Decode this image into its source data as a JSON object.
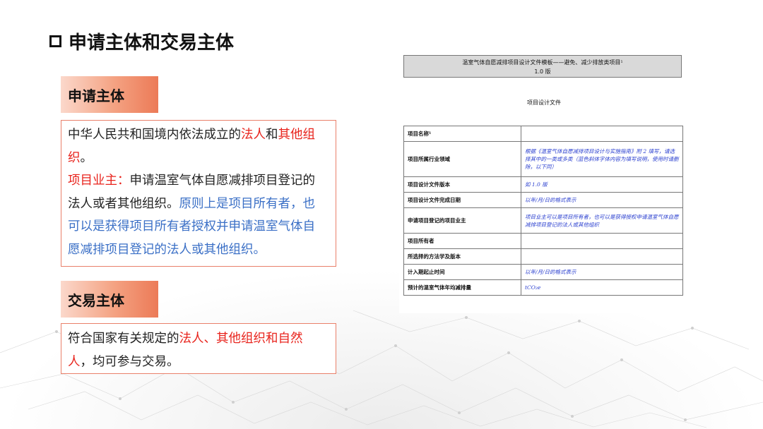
{
  "title": "申请主体和交易主体",
  "apply": {
    "label": "申请主体",
    "p1_a": "中华人民共和国境内依法成立的",
    "p1_red1": "法人",
    "p1_b": "和",
    "p1_red2": "其他组织",
    "p1_c": "。",
    "p2_red": "项目业主：",
    "p2_a": "申请温室气体自愿减排项目登记的法人或者其他组织。",
    "p2_blue": "原则上是项目所有者，也可以是获得项目所有者授权并申请温室气体自愿减排项目登记的法人或其他组织。"
  },
  "trade": {
    "label": "交易主体",
    "a": "符合国家有关规定的",
    "red": "法人、其他组织和自然人",
    "b": "，均可参与交易。"
  },
  "doc": {
    "header_line1": "温室气体自愿减排项目设计文件模板——避免、减少排放类项目¹",
    "header_line2": "1.0 版",
    "subtitle": "项目设计文件",
    "rows": [
      {
        "k": "项目名称¹",
        "v": ""
      },
      {
        "k": "项目所属行业领域",
        "v": "根据《温室气体自愿减排项目设计与实施指南》附 2 填写，请选择其中的一类或多类（蓝色斜体字体内容为填写说明，使用时请删除，以下同）"
      },
      {
        "k": "项目设计文件版本",
        "v": "如 1.0 版"
      },
      {
        "k": "项目设计文件完成日期",
        "v": "以年/月/日的格式表示"
      },
      {
        "k": "申请项目登记的项目业主",
        "v": "项目业主可以是项目所有者，也可以是获得授权申请温室气体自愿减排项目登记的法人或其他组织"
      },
      {
        "k": "项目所有者",
        "v": ""
      },
      {
        "k": "所选择的方法学及版本",
        "v": ""
      },
      {
        "k": "计入期起止时间",
        "v": "以年/月/日的格式表示"
      },
      {
        "k": "预计的温室气体年均减排量",
        "v": "tCO₂e"
      }
    ]
  }
}
